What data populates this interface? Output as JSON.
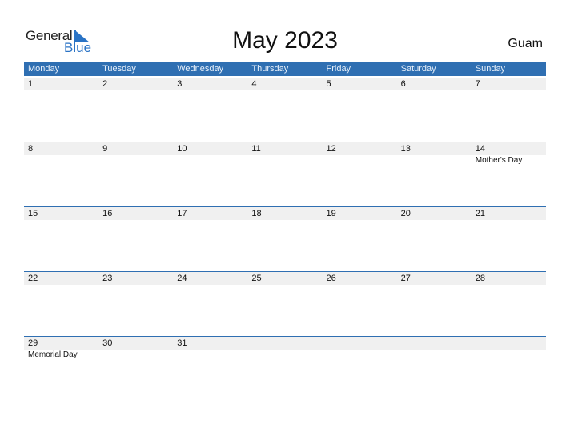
{
  "logo": {
    "word1": "General",
    "word2": "Blue"
  },
  "title": "May 2023",
  "country": "Guam",
  "colors": {
    "header_bg": "#2f6fb2",
    "date_bg": "#f0f0f0",
    "brand": "#2a73c5"
  },
  "weekdays": [
    "Monday",
    "Tuesday",
    "Wednesday",
    "Thursday",
    "Friday",
    "Saturday",
    "Sunday"
  ],
  "weeks": [
    {
      "dates": [
        "1",
        "2",
        "3",
        "4",
        "5",
        "6",
        "7"
      ],
      "events": [
        "",
        "",
        "",
        "",
        "",
        "",
        ""
      ]
    },
    {
      "dates": [
        "8",
        "9",
        "10",
        "11",
        "12",
        "13",
        "14"
      ],
      "events": [
        "",
        "",
        "",
        "",
        "",
        "",
        "Mother's Day"
      ]
    },
    {
      "dates": [
        "15",
        "16",
        "17",
        "18",
        "19",
        "20",
        "21"
      ],
      "events": [
        "",
        "",
        "",
        "",
        "",
        "",
        ""
      ]
    },
    {
      "dates": [
        "22",
        "23",
        "24",
        "25",
        "26",
        "27",
        "28"
      ],
      "events": [
        "",
        "",
        "",
        "",
        "",
        "",
        ""
      ]
    },
    {
      "dates": [
        "29",
        "30",
        "31",
        "",
        "",
        "",
        ""
      ],
      "events": [
        "Memorial Day",
        "",
        "",
        "",
        "",
        "",
        ""
      ]
    }
  ]
}
